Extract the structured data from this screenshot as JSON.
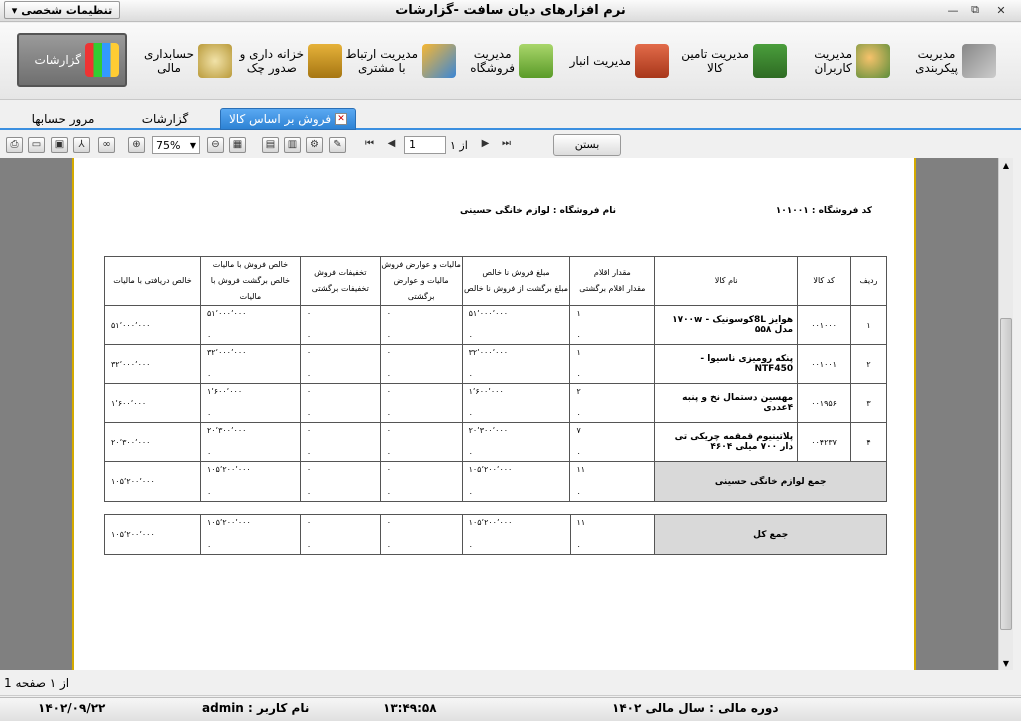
{
  "titlebar": {
    "settings_label": "تنظیمات شخصی",
    "title": "نرم افزارهای دیان سافت -گزارشات"
  },
  "ribbon": [
    {
      "label": "مدیریت\nپیکربندی",
      "icon": "tools-icon"
    },
    {
      "label": "مدیریت\nکاربران",
      "icon": "users-icon"
    },
    {
      "label": "مدیریت تامین\nکالا",
      "icon": "truck-icon"
    },
    {
      "label": "مدیریت انبار",
      "icon": "warehouse-icon"
    },
    {
      "label": "مدیریت\nفروشگاه",
      "icon": "shopping-bag-icon"
    },
    {
      "label": "مدیریت ارتباط\nبا مشتری",
      "icon": "shapes-icon"
    },
    {
      "label": "خزانه داری و\nصدور چک",
      "icon": "safe-icon"
    },
    {
      "label": "حسابداری\nمالی",
      "icon": "money-bag-icon"
    },
    {
      "label": "گزارشات",
      "icon": "bar-chart-icon"
    }
  ],
  "tabs": [
    "فروش بر اساس کالا",
    "گزارشات",
    "مرور حسابها"
  ],
  "toolbar": {
    "zoom": "75%",
    "page_of": "از ۱",
    "page": "1",
    "close_label": "بستن"
  },
  "report": {
    "store_code": "کد فروشگاه : ۱۰۱۰۰۱",
    "store_name": "نام فروشگاه : لوازم خانگی حسینی",
    "headers": [
      {
        "top": "ردیف",
        "bottom": ""
      },
      {
        "top": "کد کالا",
        "bottom": ""
      },
      {
        "top": "نام کالا",
        "bottom": ""
      },
      {
        "top": "مقدار اقلام",
        "bottom": "مقدار اقلام برگشتی"
      },
      {
        "top": "مبلغ فروش نا خالص",
        "bottom": "مبلغ برگشت از فروش نا خالص"
      },
      {
        "top": "مالیات و عوارض فروش",
        "bottom": "مالیات و عوارض برگشتی"
      },
      {
        "top": "تخفیفات فروش",
        "bottom": "تخفیفات برگشتی"
      },
      {
        "top": "خالص فروش با مالیات",
        "bottom": "خالص برگشت فروش با مالیات"
      },
      {
        "top": "خالص دریافتی با مالیات",
        "bottom": ""
      }
    ],
    "rows": [
      {
        "n": "۱",
        "code": "۰۰۱۰۰۰",
        "name": "هوایز 8Lکوسونیک - ۱۷۰۰w مدل ۵۵۸",
        "qty": "۱",
        "qty_r": "۰",
        "gross": "۵۱٬۰۰۰٬۰۰۰",
        "gross_r": "۰",
        "tax": "۰",
        "tax_r": "۰",
        "disc": "۰",
        "disc_r": "۰",
        "net": "۵۱٬۰۰۰٬۰۰۰",
        "net_r": "۰",
        "recv": "۵۱٬۰۰۰٬۰۰۰"
      },
      {
        "n": "۲",
        "code": "۰۰۱۰۰۱",
        "name": "پنکه رومیزی ناسیوا - NTF450",
        "qty": "۱",
        "qty_r": "۰",
        "gross": "۳۲٬۰۰۰٬۰۰۰",
        "gross_r": "۰",
        "tax": "۰",
        "tax_r": "۰",
        "disc": "۰",
        "disc_r": "۰",
        "net": "۳۲٬۰۰۰٬۰۰۰",
        "net_r": "۰",
        "recv": "۳۲٬۰۰۰٬۰۰۰"
      },
      {
        "n": "۳",
        "code": "۰۰۱۹۵۶",
        "name": "مهسین دستمال نخ و پنبه ۴عددی",
        "qty": "۲",
        "qty_r": "۰",
        "gross": "۱٬۶۰۰٬۰۰۰",
        "gross_r": "۰",
        "tax": "۰",
        "tax_r": "۰",
        "disc": "۰",
        "disc_r": "۰",
        "net": "۱٬۶۰۰٬۰۰۰",
        "net_r": "۰",
        "recv": "۱٬۶۰۰٬۰۰۰"
      },
      {
        "n": "۴",
        "code": "۰۰۴۲۳۷",
        "name": "پلاتینیوم قمقمه چریکی تی دار ۷۰۰ میلی ۴۶۰۴",
        "qty": "۷",
        "qty_r": "۰",
        "gross": "۲۰٬۳۰۰٬۰۰۰",
        "gross_r": "۰",
        "tax": "۰",
        "tax_r": "۰",
        "disc": "۰",
        "disc_r": "۰",
        "net": "۲۰٬۳۰۰٬۰۰۰",
        "net_r": "۰",
        "recv": "۲۰٬۳۰۰٬۰۰۰"
      }
    ],
    "subtotal": {
      "label": "جمع لوازم خانگی حسینی",
      "qty": "۱۱",
      "qty_r": "۰",
      "gross": "۱۰۵٬۲۰۰٬۰۰۰",
      "gross_r": "۰",
      "tax": "۰",
      "tax_r": "۰",
      "disc": "۰",
      "disc_r": "۰",
      "net": "۱۰۵٬۲۰۰٬۰۰۰",
      "net_r": "۰",
      "recv": "۱۰۵٬۲۰۰٬۰۰۰"
    },
    "total": {
      "label": "جمع کل",
      "qty": "۱۱",
      "qty_r": "۰",
      "gross": "۱۰۵٬۲۰۰٬۰۰۰",
      "gross_r": "۰",
      "tax": "۰",
      "tax_r": "۰",
      "disc": "۰",
      "disc_r": "۰",
      "net": "۱۰۵٬۲۰۰٬۰۰۰",
      "net_r": "۰",
      "recv": "۱۰۵٬۲۰۰٬۰۰۰"
    }
  },
  "pagecount": "از ۱ صفحه 1",
  "status": {
    "fiscal": "دوره مالی : سال مالی ۱۴۰۲",
    "time": "۱۳:۴۹:۵۸",
    "user": "نام کاربر : admin",
    "date": "۱۴۰۲/۰۹/۲۲"
  }
}
